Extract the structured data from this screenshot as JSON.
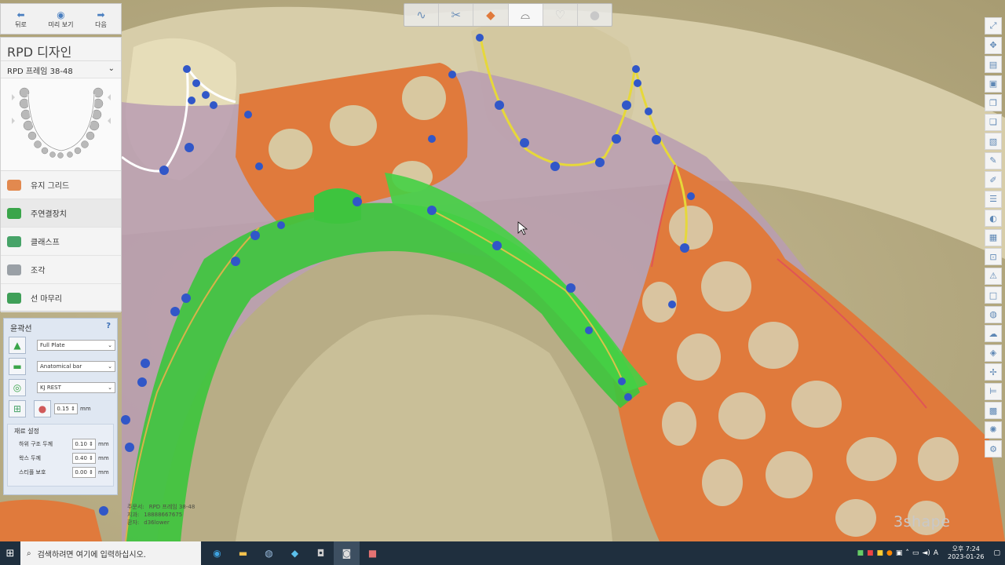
{
  "nav": {
    "back": "뒤로",
    "preview": "미리 보기",
    "next": "다음"
  },
  "panel": {
    "title": "RPD 디자인",
    "subtitle": "RPD 프레임 38-48",
    "steps": [
      {
        "label": "유지 그리드",
        "color": "#e2894f"
      },
      {
        "label": "주연결장치",
        "color": "#3aa54a"
      },
      {
        "label": "클래스프",
        "color": "#47a368"
      },
      {
        "label": "조각",
        "color": "#9aa0a6"
      },
      {
        "label": "선 마무리",
        "color": "#3f9f58"
      }
    ]
  },
  "props": {
    "title": "윤곽선",
    "help": "?",
    "type": "Full Plate",
    "bar": "Anatomical bar",
    "rest": "KJ REST",
    "thickness": "0.15",
    "unit": "mm",
    "material": {
      "title": "재료 설정",
      "rows": [
        {
          "label": "하위 구조 두께",
          "value": "0.10",
          "unit": "mm"
        },
        {
          "label": "왁스 두께",
          "value": "0.40",
          "unit": "mm"
        },
        {
          "label": "스티플 보호",
          "value": "0.00",
          "unit": "mm"
        }
      ]
    }
  },
  "order_info": {
    "order_label": "주문서:",
    "order_value": "RPD 프레임 38-48",
    "lab_label": "지과:",
    "lab_value": "18888667675",
    "patient_label": "환자:",
    "patient_value": "d36lower"
  },
  "brand": "3shape",
  "taskbar": {
    "search_placeholder": "검색하려면 여기에 입력하십시오.",
    "time": "오후 7:24",
    "date": "2023-01-26",
    "lang": "A"
  },
  "colors": {
    "framework": "#e07a3c",
    "connector": "#3ec43e",
    "tissue": "#b99ab0",
    "model": "#c7bb95"
  }
}
